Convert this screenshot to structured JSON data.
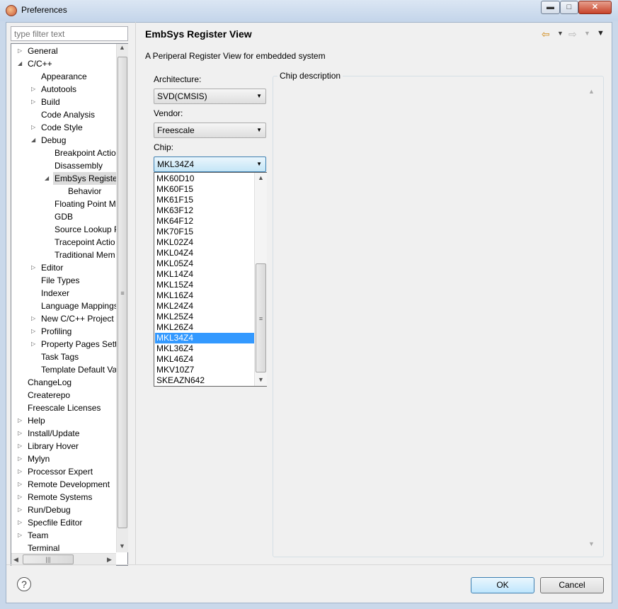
{
  "window": {
    "title": "Preferences"
  },
  "filter": {
    "placeholder": "type filter text"
  },
  "tree": [
    {
      "label": "General",
      "level": 0,
      "twisty": "closed"
    },
    {
      "label": "C/C++",
      "level": 0,
      "twisty": "open"
    },
    {
      "label": "Appearance",
      "level": 1,
      "twisty": "none"
    },
    {
      "label": "Autotools",
      "level": 1,
      "twisty": "closed"
    },
    {
      "label": "Build",
      "level": 1,
      "twisty": "closed"
    },
    {
      "label": "Code Analysis",
      "level": 1,
      "twisty": "none"
    },
    {
      "label": "Code Style",
      "level": 1,
      "twisty": "closed"
    },
    {
      "label": "Debug",
      "level": 1,
      "twisty": "open"
    },
    {
      "label": "Breakpoint Actio",
      "level": 2,
      "twisty": "none"
    },
    {
      "label": "Disassembly",
      "level": 2,
      "twisty": "none"
    },
    {
      "label": "EmbSys Register",
      "level": 2,
      "twisty": "open",
      "selected": true
    },
    {
      "label": "Behavior",
      "level": 3,
      "twisty": "none"
    },
    {
      "label": "Floating Point M",
      "level": 2,
      "twisty": "none"
    },
    {
      "label": "GDB",
      "level": 2,
      "twisty": "none"
    },
    {
      "label": "Source Lookup P",
      "level": 2,
      "twisty": "none"
    },
    {
      "label": "Tracepoint Actio",
      "level": 2,
      "twisty": "none"
    },
    {
      "label": "Traditional Mem",
      "level": 2,
      "twisty": "none"
    },
    {
      "label": "Editor",
      "level": 1,
      "twisty": "closed"
    },
    {
      "label": "File Types",
      "level": 1,
      "twisty": "none"
    },
    {
      "label": "Indexer",
      "level": 1,
      "twisty": "none"
    },
    {
      "label": "Language Mappings",
      "level": 1,
      "twisty": "none"
    },
    {
      "label": "New C/C++ Project",
      "level": 1,
      "twisty": "closed"
    },
    {
      "label": "Profiling",
      "level": 1,
      "twisty": "closed"
    },
    {
      "label": "Property Pages Setti",
      "level": 1,
      "twisty": "closed"
    },
    {
      "label": "Task Tags",
      "level": 1,
      "twisty": "none"
    },
    {
      "label": "Template Default Va",
      "level": 1,
      "twisty": "none"
    },
    {
      "label": "ChangeLog",
      "level": 0,
      "twisty": "none"
    },
    {
      "label": "Createrepo",
      "level": 0,
      "twisty": "none"
    },
    {
      "label": "Freescale Licenses",
      "level": 0,
      "twisty": "none"
    },
    {
      "label": "Help",
      "level": 0,
      "twisty": "closed"
    },
    {
      "label": "Install/Update",
      "level": 0,
      "twisty": "closed"
    },
    {
      "label": "Library Hover",
      "level": 0,
      "twisty": "closed"
    },
    {
      "label": "Mylyn",
      "level": 0,
      "twisty": "closed"
    },
    {
      "label": "Processor Expert",
      "level": 0,
      "twisty": "closed"
    },
    {
      "label": "Remote Development",
      "level": 0,
      "twisty": "closed"
    },
    {
      "label": "Remote Systems",
      "level": 0,
      "twisty": "closed"
    },
    {
      "label": "Run/Debug",
      "level": 0,
      "twisty": "closed"
    },
    {
      "label": "Specfile Editor",
      "level": 0,
      "twisty": "closed"
    },
    {
      "label": "Team",
      "level": 0,
      "twisty": "closed"
    },
    {
      "label": "Terminal",
      "level": 0,
      "twisty": "none"
    }
  ],
  "page": {
    "title": "EmbSys Register View",
    "description": "A Periperal Register View for embedded system",
    "architecture_label": "Architecture:",
    "architecture_value": "SVD(CMSIS)",
    "vendor_label": "Vendor:",
    "vendor_value": "Freescale",
    "chip_label": "Chip:",
    "chip_value": "MKL34Z4",
    "chip_options": [
      "MK60D10",
      "MK60F15",
      "MK61F15",
      "MK63F12",
      "MK64F12",
      "MK70F15",
      "MKL02Z4",
      "MKL04Z4",
      "MKL05Z4",
      "MKL14Z4",
      "MKL15Z4",
      "MKL16Z4",
      "MKL24Z4",
      "MKL25Z4",
      "MKL26Z4",
      "MKL34Z4",
      "MKL36Z4",
      "MKL46Z4",
      "MKV10Z7",
      "SKEAZN642"
    ],
    "chip_selected_index": 15,
    "chip_description_label": "Chip description"
  },
  "buttons": {
    "ok": "OK",
    "cancel": "Cancel"
  },
  "icons": {
    "help": "help-icon",
    "back": "back-arrow-icon",
    "forward": "forward-arrow-icon",
    "menu": "view-menu-icon"
  }
}
